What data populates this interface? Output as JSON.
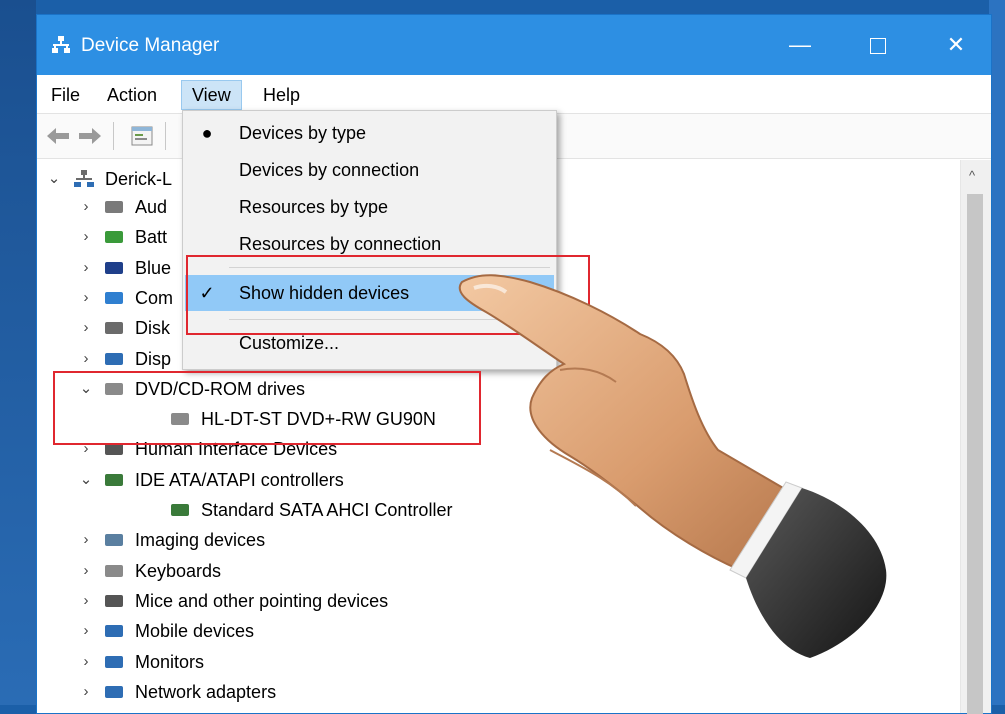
{
  "window": {
    "title": "Device Manager",
    "minimize": "—",
    "close": "✕"
  },
  "menubar": {
    "file": "File",
    "action": "Action",
    "view": "View",
    "help": "Help"
  },
  "view_menu": {
    "items": [
      {
        "label": "Devices by type",
        "mark": "●"
      },
      {
        "label": "Devices by connection",
        "mark": ""
      },
      {
        "label": "Resources by type",
        "mark": ""
      },
      {
        "label": "Resources by connection",
        "mark": ""
      },
      {
        "label": "Show hidden devices",
        "mark": "✓"
      },
      {
        "label": "Customize...",
        "mark": ""
      }
    ]
  },
  "tree": {
    "root": "Derick-L",
    "items": [
      {
        "label": "Aud",
        "expander": "›"
      },
      {
        "label": "Batt",
        "expander": "›"
      },
      {
        "label": "Blue",
        "expander": "›"
      },
      {
        "label": "Com",
        "expander": "›"
      },
      {
        "label": "Disk",
        "expander": "›"
      },
      {
        "label": "Disp",
        "expander": "›"
      },
      {
        "label": "DVD/CD-ROM drives",
        "expander": "⌄"
      },
      {
        "label": "HL-DT-ST DVD+-RW GU90N",
        "expander": ""
      },
      {
        "label": "Human Interface Devices",
        "expander": "›"
      },
      {
        "label": "IDE ATA/ATAPI controllers",
        "expander": "⌄"
      },
      {
        "label": "Standard SATA AHCI Controller",
        "expander": ""
      },
      {
        "label": "Imaging devices",
        "expander": "›"
      },
      {
        "label": "Keyboards",
        "expander": "›"
      },
      {
        "label": "Mice and other pointing devices",
        "expander": "›"
      },
      {
        "label": "Mobile devices",
        "expander": "›"
      },
      {
        "label": "Monitors",
        "expander": "›"
      },
      {
        "label": "Network adapters",
        "expander": "›"
      }
    ]
  },
  "colors": {
    "titlebar": "#2d8fe3",
    "menu_highlight": "#91c9f7",
    "annotation": "#e0272f"
  },
  "scrollbar": {
    "up": "^"
  }
}
